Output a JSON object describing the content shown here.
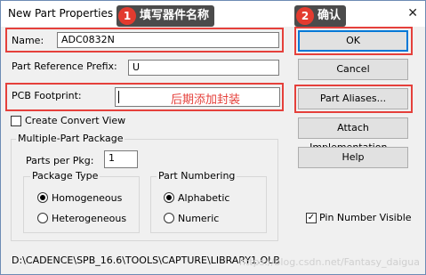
{
  "window": {
    "title": "New Part Properties",
    "close_glyph": "✕"
  },
  "fields": {
    "name_label": "Name:",
    "name_value": "ADC0832N",
    "prefix_label": "Part Reference Prefix:",
    "prefix_value": "U",
    "footprint_label": "PCB Footprint:",
    "footprint_value": "",
    "create_convert_label": "Create Convert View",
    "create_convert_checked": false
  },
  "buttons": {
    "ok": "OK",
    "cancel": "Cancel",
    "part_aliases": "Part Aliases...",
    "attach_impl": "Attach Implementation...",
    "help": "Help"
  },
  "multipart": {
    "title": "Multiple-Part Package",
    "parts_label": "Parts per Pkg:",
    "parts_value": "1",
    "package_type_title": "Package Type",
    "homogeneous": "Homogeneous",
    "heterogeneous": "Heterogeneous",
    "numbering_title": "Part Numbering",
    "alphabetic": "Alphabetic",
    "numeric": "Numeric"
  },
  "pin_number_visible": {
    "label": "Pin Number Visible",
    "checked": true
  },
  "library_path": "D:\\CADENCE\\SPB_16.6\\TOOLS\\CAPTURE\\LIBRARY1.OLB",
  "annotations": {
    "step1_number": "1",
    "step1_text": "填写器件名称",
    "step2_number": "2",
    "step2_text": "确认",
    "later_text": "后期添加封装"
  },
  "watermark": "https://blog.csdn.net/Fantasy_daigua",
  "colors": {
    "highlight_red": "#e5403b",
    "annotation_bg": "#4b4b4b",
    "badge_red": "#e33b2f",
    "focus_blue": "#0078d7"
  }
}
